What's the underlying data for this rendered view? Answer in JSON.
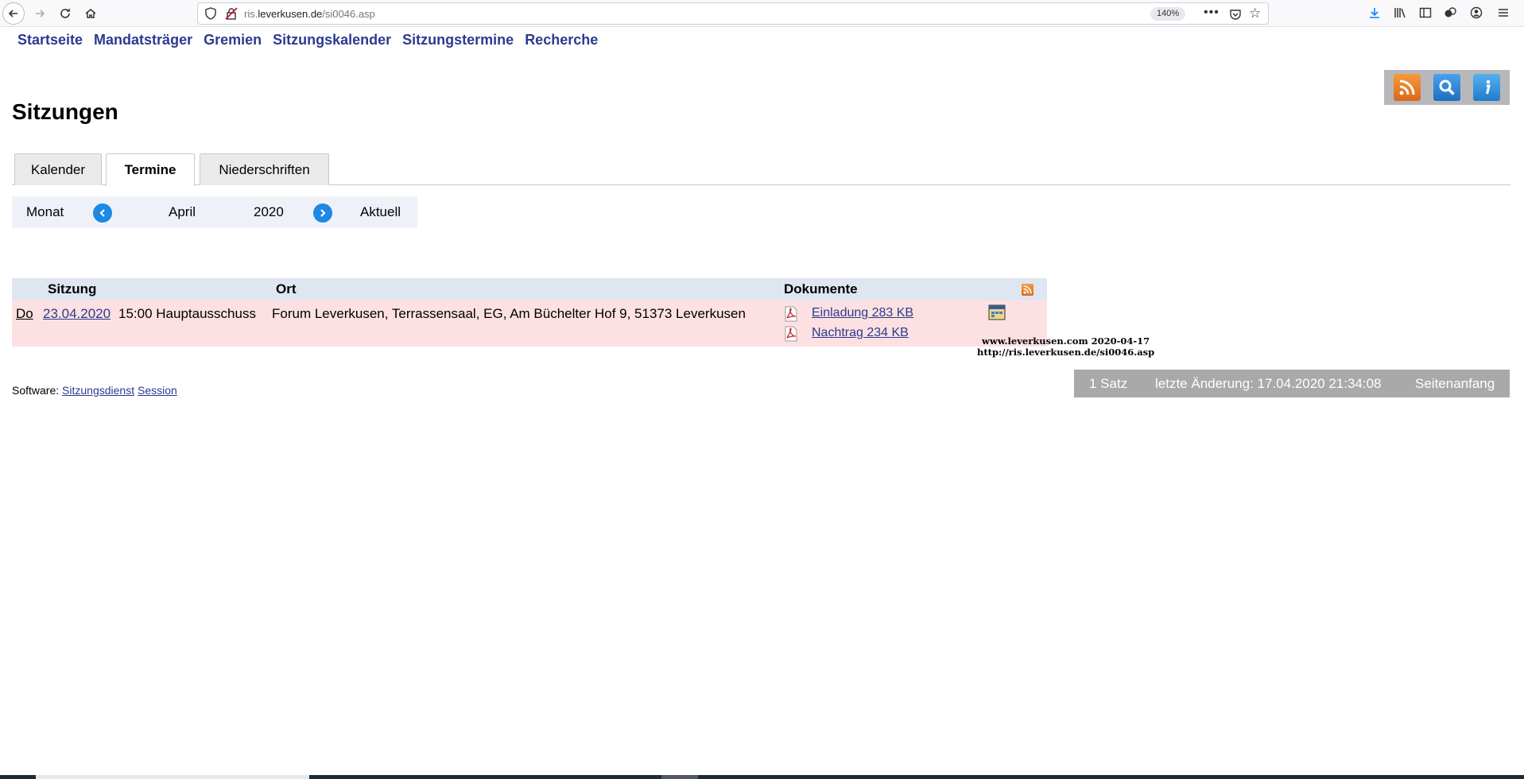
{
  "browser": {
    "url_prefix": "ris.",
    "url_host": "leverkusen.de",
    "url_path": "/si0046.asp",
    "zoom": "140%"
  },
  "topnav": [
    "Startseite",
    "Mandatsträger",
    "Gremien",
    "Sitzungskalender",
    "Sitzungstermine",
    "Recherche"
  ],
  "page_title": "Sitzungen",
  "tabs": [
    "Kalender",
    "Termine",
    "Niederschriften"
  ],
  "active_tab": "Termine",
  "monthnav": {
    "label": "Monat",
    "month": "April",
    "year": "2020",
    "current": "Aktuell"
  },
  "table": {
    "headers": {
      "sitzung": "Sitzung",
      "ort": "Ort",
      "dokumente": "Dokumente"
    },
    "row": {
      "day": "Do",
      "date": "23.04.2020",
      "time_title": "15:00 Hauptausschuss",
      "ort": "Forum Leverkusen, Terrassensaal, EG, Am Büchelter Hof 9, 51373 Leverkusen",
      "documents": [
        "Einladung 283 KB",
        "Nachtrag 234 KB"
      ]
    }
  },
  "watermark": {
    "line1": "www.leverkusen.com  2020-04-17",
    "line2": "http://ris.leverkusen.de/si0046.asp"
  },
  "footer": {
    "software_label": "Software:",
    "link1": "Sitzungsdienst",
    "link2": "Session"
  },
  "status": {
    "count": "1 Satz",
    "last_change": "letzte Änderung: 17.04.2020 21:34:08",
    "top": "Seitenanfang"
  },
  "colors": {
    "link": "#2a3b8f",
    "header_bg": "#dde6f1",
    "row_bg": "#fde1e2",
    "status_bg": "#a9a9a9",
    "nav_circle": "#1e88e5"
  }
}
